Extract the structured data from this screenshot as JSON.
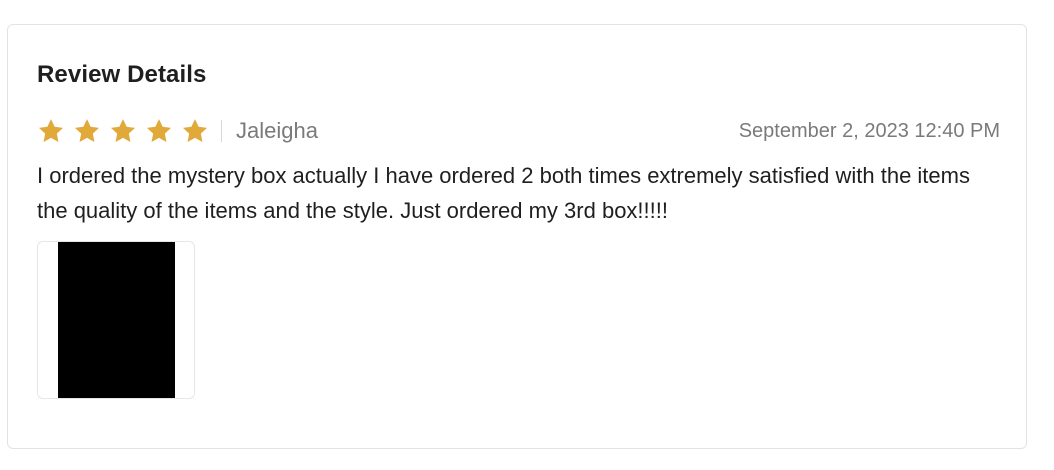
{
  "review": {
    "title": "Review Details",
    "rating": 5,
    "rating_max": 5,
    "star_color": "#E0A93A",
    "author": "Jaleigha",
    "date": "September 2, 2023 12:40 PM",
    "text": "I ordered the mystery box actually I have ordered 2 both times extremely satisfied with the items the quality of the items and the style. Just ordered my 3rd box!!!!!",
    "photos": [
      {
        "icon": "review-photo"
      }
    ]
  }
}
